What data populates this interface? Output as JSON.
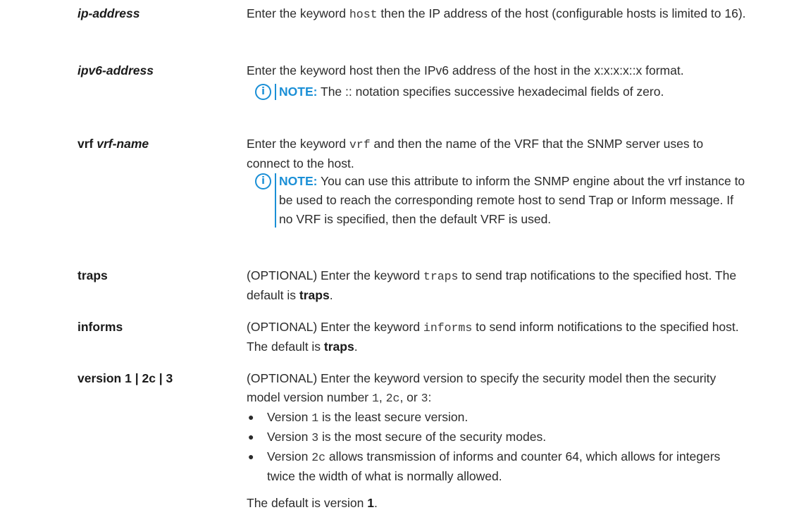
{
  "rows": {
    "ip_address": {
      "term": "ip-address",
      "desc_pre": "Enter the keyword ",
      "desc_code": "host",
      "desc_post": " then the IP address of the host (configurable hosts is limited to 16)."
    },
    "ipv6_address": {
      "term": "ipv6-address",
      "desc": "Enter the keyword host then the IPv6 address of the host in the x:x:x:x::x format.",
      "note_label": "NOTE:",
      "note_text": " The :: notation specifies successive hexadecimal fields of zero."
    },
    "vrf": {
      "term_plain": "vrf ",
      "term_italic": "vrf-name",
      "desc_pre": "Enter the keyword ",
      "desc_code": "vrf",
      "desc_post": " and then the name of the VRF that the SNMP server uses to connect to the host.",
      "note_label": "NOTE:",
      "note_text": " You can use this attribute to inform the SNMP engine about the vrf instance to be used to reach the corresponding remote host to send Trap or Inform message. If no VRF is specified, then the default VRF is used."
    },
    "traps": {
      "term": "traps",
      "desc_pre": "(OPTIONAL) Enter the keyword ",
      "desc_code": "traps",
      "desc_post": " to send trap notifications to the specified host. The default is ",
      "desc_bold": "traps",
      "desc_end": "."
    },
    "informs": {
      "term": "informs",
      "desc_pre": "(OPTIONAL) Enter the keyword ",
      "desc_code": "informs",
      "desc_post": " to send inform notifications to the specified host. The default is ",
      "desc_bold": "traps",
      "desc_end": "."
    },
    "version": {
      "term": "version 1 | 2c | 3",
      "desc_pre": "(OPTIONAL) Enter the keyword version to specify the security model then the security model version number ",
      "code_1": "1",
      "sep_1": ", ",
      "code_2c": "2c",
      "sep_2": ", or ",
      "code_3": "3",
      "desc_end": ":",
      "bullets": [
        {
          "pre": "Version ",
          "code": "1",
          "post": " is the least secure version."
        },
        {
          "pre": "Version ",
          "code": "3",
          "post": " is the most secure of the security modes."
        },
        {
          "pre": "Version ",
          "code": "2c",
          "post": " allows transmission of informs and counter 64, which allows for integers twice the width of what is normally allowed."
        }
      ],
      "default_pre": "The default is version ",
      "default_bold": "1",
      "default_end": "."
    }
  },
  "icons": {
    "note": "info-icon",
    "bullet": "bullet-icon"
  },
  "colors": {
    "note_accent": "#1a8fd6",
    "text": "#2b2b2b"
  }
}
